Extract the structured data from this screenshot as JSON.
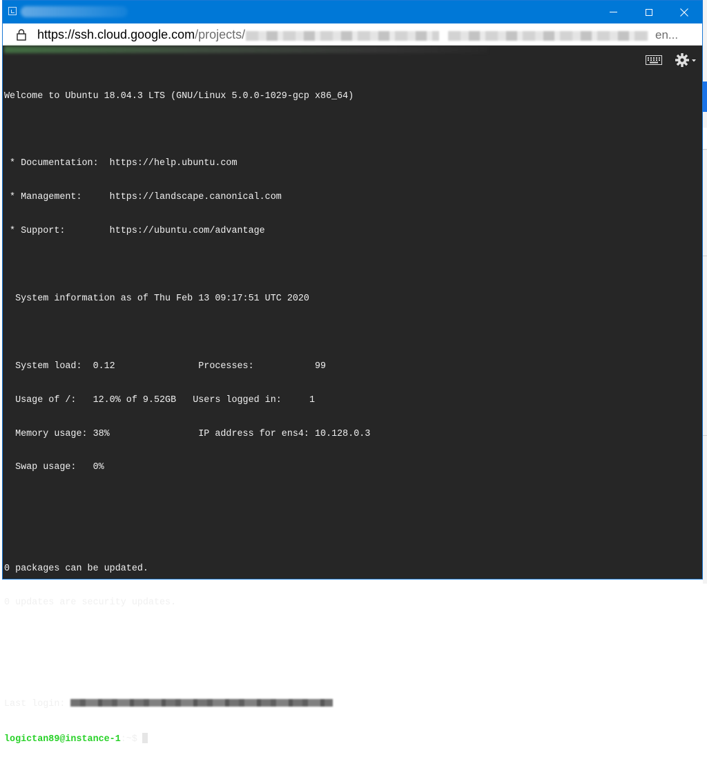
{
  "window": {
    "url_host": "https://ssh.cloud.google.com",
    "url_path": "/projects/",
    "url_tail": "en..."
  },
  "window_controls": {
    "minimize_icon": "minimize-icon",
    "maximize_icon": "maximize-icon",
    "close_icon": "close-icon"
  },
  "toolbar": {
    "keyboard_icon": "keyboard-icon",
    "settings_icon": "gear-icon"
  },
  "terminal": {
    "welcome": "Welcome to Ubuntu 18.04.3 LTS (GNU/Linux 5.0.0-1029-gcp x86_64)",
    "doc_line": " * Documentation:  https://help.ubuntu.com",
    "mgmt_line": " * Management:     https://landscape.canonical.com",
    "support_line": " * Support:        https://ubuntu.com/advantage",
    "sysinfo_line": "  System information as of Thu Feb 13 09:17:51 UTC 2020",
    "stats_line1": "  System load:  0.12               Processes:           99",
    "stats_line2": "  Usage of /:   12.0% of 9.52GB   Users logged in:     1",
    "stats_line3": "  Memory usage: 38%                IP address for ens4: 10.128.0.3",
    "stats_line4": "  Swap usage:   0%",
    "packages_line": "0 packages can be updated.",
    "security_line": "0 updates are security updates.",
    "last_login_label": "Last login:",
    "prompt_user": "logictan89@instance-1",
    "prompt_path": ":~$"
  },
  "colors": {
    "titlebar": "#0078d7",
    "terminal_bg": "#262626",
    "terminal_fg": "#f0f0f0",
    "prompt_user": "#27d127"
  }
}
